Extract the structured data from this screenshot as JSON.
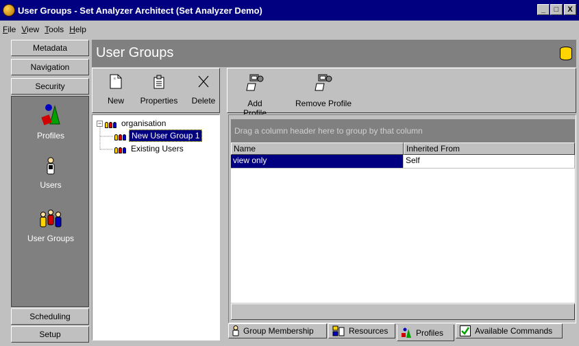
{
  "window": {
    "title": "User Groups - Set Analyzer Architect (Set Analyzer Demo)",
    "controls": {
      "minimize": "_",
      "maximize": "□",
      "close": "X"
    }
  },
  "menu": [
    {
      "label": "File",
      "hotkey": "F",
      "rest": "ile"
    },
    {
      "label": "View",
      "hotkey": "V",
      "rest": "iew"
    },
    {
      "label": "Tools",
      "hotkey": "T",
      "rest": "ools"
    },
    {
      "label": "Help",
      "hotkey": "H",
      "rest": "elp"
    }
  ],
  "leftnav": {
    "top_buttons": [
      "Metadata",
      "Navigation",
      "Security"
    ],
    "items": [
      {
        "label": "Profiles",
        "icon": "profiles-icon"
      },
      {
        "label": "Users",
        "icon": "user-icon"
      },
      {
        "label": "User Groups",
        "icon": "user-groups-icon"
      }
    ],
    "bottom_buttons": [
      "Scheduling",
      "Setup"
    ]
  },
  "header": {
    "title": "User Groups",
    "icon": "database-icon"
  },
  "toolbar_left": [
    {
      "label": "New",
      "icon": "new-document-icon"
    },
    {
      "label": "Properties",
      "icon": "properties-icon"
    },
    {
      "label": "Delete",
      "icon": "delete-x-icon"
    }
  ],
  "toolbar_right": [
    {
      "label": "Add Profile",
      "icon": "add-profile-icon"
    },
    {
      "label": "Remove Profile",
      "icon": "remove-profile-icon"
    }
  ],
  "tree": {
    "root": {
      "label": "organisation",
      "expander": "−"
    },
    "children": [
      {
        "label": "New User Group 1",
        "selected": true
      },
      {
        "label": "Existing Users",
        "selected": false
      }
    ]
  },
  "grid": {
    "group_hint": "Drag a column header here to group by that column",
    "columns": [
      "Name",
      "Inherited From"
    ],
    "rows": [
      {
        "name": "view only",
        "inherited_from": "Self"
      }
    ]
  },
  "tabs": [
    {
      "label": "Group Membership",
      "icon": "user-icon",
      "active": false
    },
    {
      "label": "Resources",
      "icon": "resources-icon",
      "active": false
    },
    {
      "label": "Profiles",
      "icon": "profiles-icon",
      "active": true
    },
    {
      "label": "Available Commands",
      "icon": "checkmark-icon",
      "active": false
    }
  ],
  "colors": {
    "titlebar": "#000080",
    "face": "#c0c0c0",
    "dark_panel": "#808080",
    "selection": "#000080"
  }
}
